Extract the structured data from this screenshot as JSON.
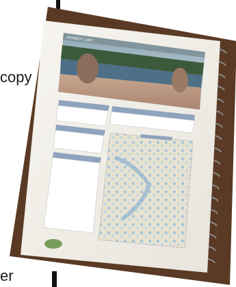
{
  "background": {
    "left_text": "copy",
    "bottom_text": "er"
  },
  "photo": {
    "page_title": "KENNEDY LAKE"
  },
  "colors": {
    "cover_brown": "#5a3a24",
    "page": "#f3f1ec",
    "table_header": "#8ea3bd",
    "map_water": "#a9c6dd",
    "map_land": "#e6e2d2"
  }
}
